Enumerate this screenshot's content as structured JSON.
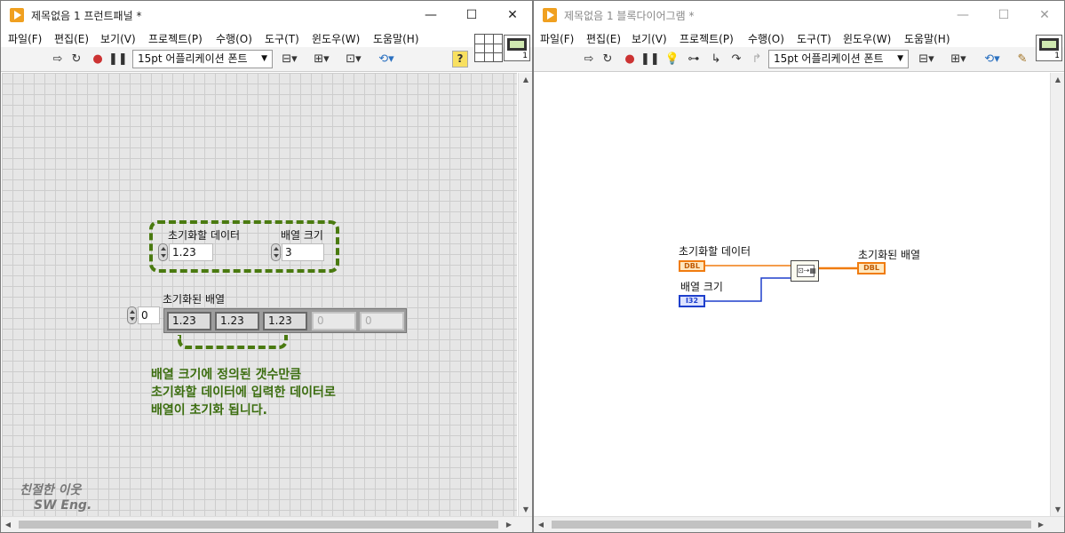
{
  "front_panel": {
    "title": "제목없음 1 프런트패널 *",
    "menu": [
      "파일(F)",
      "편집(E)",
      "보기(V)",
      "프로젝트(P)",
      "수행(O)",
      "도구(T)",
      "윈도우(W)",
      "도움말(H)"
    ],
    "font_select": "15pt 어플리케이션 폰트",
    "help": "?",
    "vi_number": "1",
    "controls": {
      "init_data_label": "초기화할 데이터",
      "init_data_value": "1.23",
      "array_size_label": "배열 크기",
      "array_size_value": "3"
    },
    "array_indicator": {
      "label": "초기화된 배열",
      "index": "0",
      "elements": [
        "1.23",
        "1.23",
        "1.23",
        "0",
        "0"
      ]
    },
    "note_lines": [
      "배열 크기에 정의된 갯수만큼",
      "초기화할 데이터에 입력한 데이터로",
      "배열이 초기화 됩니다."
    ],
    "watermark_lines": [
      "친절한 이웃",
      "SW Eng."
    ]
  },
  "block_diagram": {
    "title": "제목없음 1 블록다이어그램 *",
    "menu": [
      "파일(F)",
      "편집(E)",
      "보기(V)",
      "프로젝트(P)",
      "수행(O)",
      "도구(T)",
      "윈도우(W)",
      "도움말(H)"
    ],
    "font_select": "15pt 어플리케이션 폰트",
    "vi_number": "1",
    "nodes": {
      "init_data_label": "초기화할 데이터",
      "init_data_type": "DBL",
      "array_size_label": "배열 크기",
      "array_size_type": "I32",
      "result_label": "초기화된 배열",
      "result_type": "DBL"
    }
  },
  "window_controls": {
    "minimize": "—",
    "maximize": "☐",
    "close": "✕"
  },
  "colors": {
    "dbl_wire": "#f07c10",
    "i32_wire": "#1e3fcc",
    "annotation": "#3c6e10"
  }
}
